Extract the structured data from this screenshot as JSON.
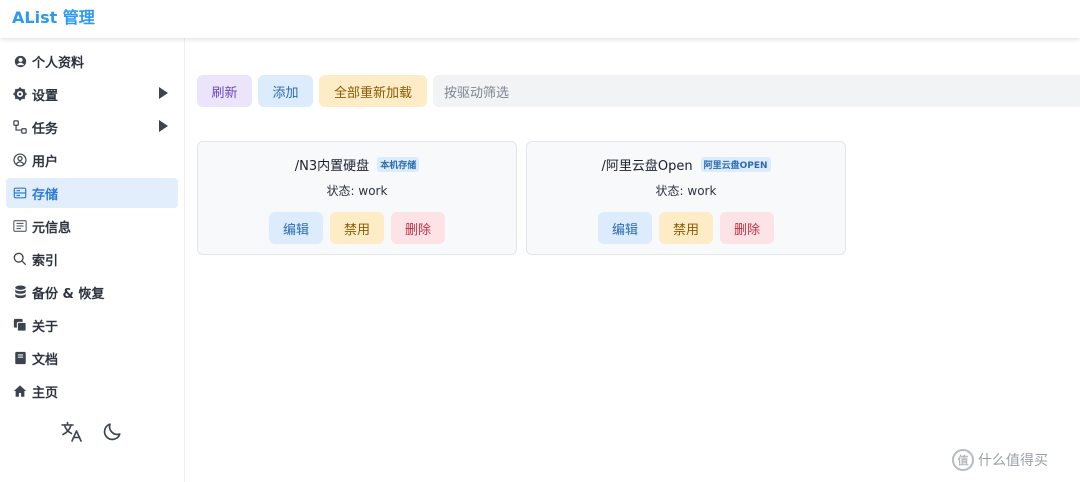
{
  "header": {
    "title": "AList 管理"
  },
  "sidebar": {
    "items": [
      {
        "label": "个人资料",
        "icon": "user-profile-icon",
        "arrow": false,
        "active": false
      },
      {
        "label": "设置",
        "icon": "gear-icon",
        "arrow": true,
        "active": false
      },
      {
        "label": "任务",
        "icon": "task-flow-icon",
        "arrow": true,
        "active": false
      },
      {
        "label": "用户",
        "icon": "user-circle-icon",
        "arrow": false,
        "active": false
      },
      {
        "label": "存储",
        "icon": "storage-icon",
        "arrow": false,
        "active": true
      },
      {
        "label": "元信息",
        "icon": "meta-info-icon",
        "arrow": false,
        "active": false
      },
      {
        "label": "索引",
        "icon": "search-icon",
        "arrow": false,
        "active": false
      },
      {
        "label": "备份 & 恢复",
        "icon": "database-icon",
        "arrow": false,
        "active": false
      },
      {
        "label": "关于",
        "icon": "copy-icon",
        "arrow": false,
        "active": false
      },
      {
        "label": "文档",
        "icon": "book-icon",
        "arrow": false,
        "active": false
      },
      {
        "label": "主页",
        "icon": "home-icon",
        "arrow": false,
        "active": false
      }
    ]
  },
  "toolbar": {
    "refresh_label": "刷新",
    "add_label": "添加",
    "reload_all_label": "全部重新加载",
    "filter_placeholder": "按驱动筛选"
  },
  "storages": [
    {
      "path": "/N3内置硬盘",
      "driver": "本机存储",
      "status": "状态: work",
      "edit": "编辑",
      "disable": "禁用",
      "delete": "删除"
    },
    {
      "path": "/阿里云盘Open",
      "driver": "阿里云盘OPEN",
      "status": "状态: work",
      "edit": "编辑",
      "disable": "禁用",
      "delete": "删除"
    }
  ],
  "watermark": {
    "text": "什么值得买",
    "logo": "值"
  },
  "colors": {
    "accent": "#2b9af3",
    "active_bg": "#e3eefc"
  }
}
